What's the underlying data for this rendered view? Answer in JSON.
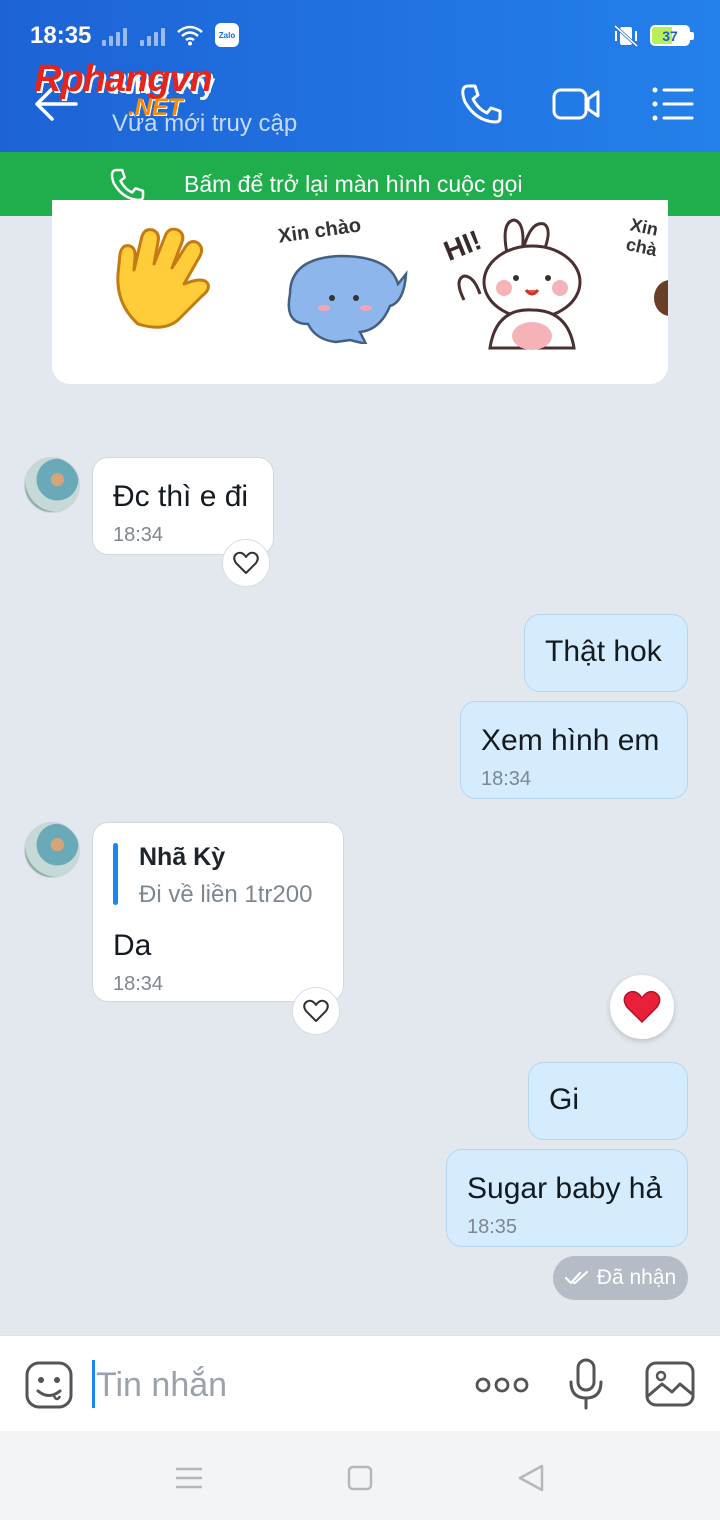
{
  "status_bar": {
    "time": "18:35",
    "battery": "37",
    "app_badge": "Zalo"
  },
  "header": {
    "contact_name": "Nhã Kỳ",
    "contact_status": "Vừa mới truy cập",
    "watermark_line1": "Rphangvn",
    "watermark_line2": ".NET"
  },
  "call_banner": {
    "text": "Bấm để trở lại màn hình cuộc gọi"
  },
  "stickers": [
    {
      "name": "waving-hand",
      "label": ""
    },
    {
      "name": "blue-cat-sticker",
      "label": "Xin chào"
    },
    {
      "name": "bunny-sticker",
      "label": "HI!"
    },
    {
      "name": "partial-sticker",
      "label": "Xin chà"
    }
  ],
  "messages": [
    {
      "side": "in",
      "text": "Đc thì e đi",
      "time": "18:34"
    },
    {
      "side": "out",
      "text": "Thật hok",
      "time": ""
    },
    {
      "side": "out",
      "text": "Xem hình em",
      "time": "18:34"
    },
    {
      "side": "in",
      "quote_name": "Nhã Kỳ",
      "quote_text": "Đi về liền 1tr200",
      "text": "Da",
      "time": "18:34"
    },
    {
      "side": "out",
      "text": "Gi",
      "time": ""
    },
    {
      "side": "out",
      "text": "Sugar baby hả",
      "time": "18:35"
    }
  ],
  "delivery_status": "Đã nhận",
  "input": {
    "placeholder": "Tin nhắn"
  },
  "colors": {
    "header_blue": "#1d63d6",
    "call_green": "#1fae4b",
    "out_bubble": "#d4ecfd",
    "accent": "#1b86ef"
  }
}
